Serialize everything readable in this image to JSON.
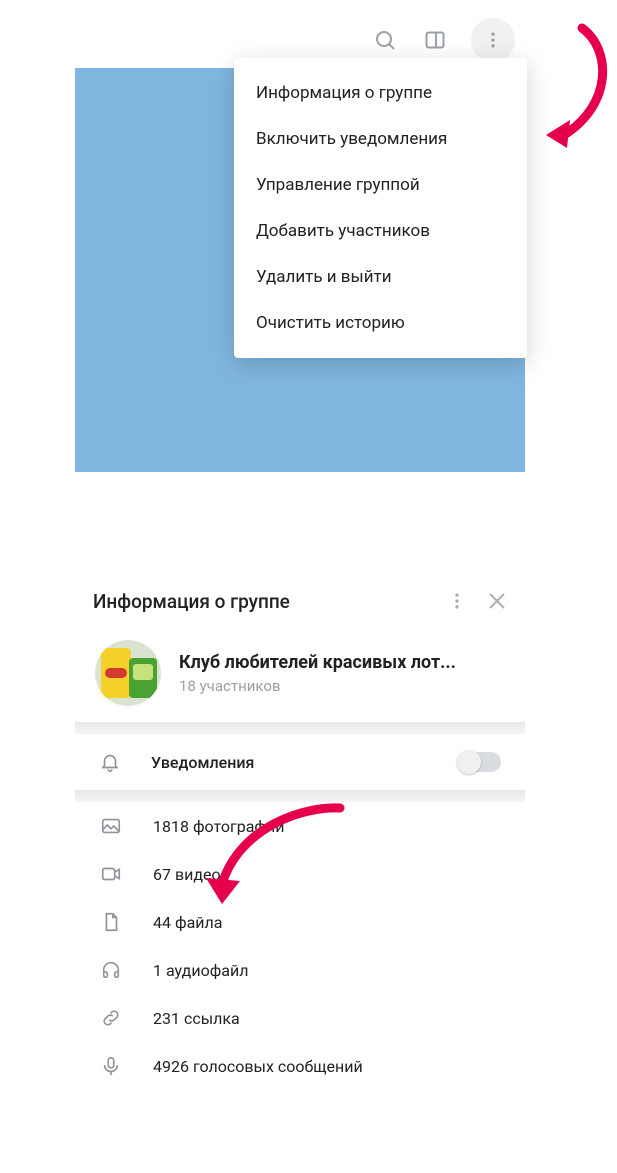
{
  "menu": {
    "items": [
      "Информация о группе",
      "Включить  уведомления",
      "Управление группой",
      "Добавить участников",
      "Удалить и выйти",
      "Очистить историю"
    ]
  },
  "info": {
    "header": "Информация о группе",
    "group_name": "Клуб любителей красивых лот...",
    "group_subtitle": "18 участников",
    "notifications_label": "Уведомления",
    "notifications_on": false,
    "media": [
      {
        "icon": "photo",
        "label": "1818 фотографий"
      },
      {
        "icon": "video",
        "label": "67 видео"
      },
      {
        "icon": "file",
        "label": "44 файла"
      },
      {
        "icon": "audio",
        "label": "1 аудиофайл"
      },
      {
        "icon": "link",
        "label": "231 ссылка"
      },
      {
        "icon": "voice",
        "label": "4926 голосовых сообщений"
      }
    ]
  },
  "colors": {
    "accent_blue": "#7fb6e0",
    "arrow": "#e6004c"
  }
}
